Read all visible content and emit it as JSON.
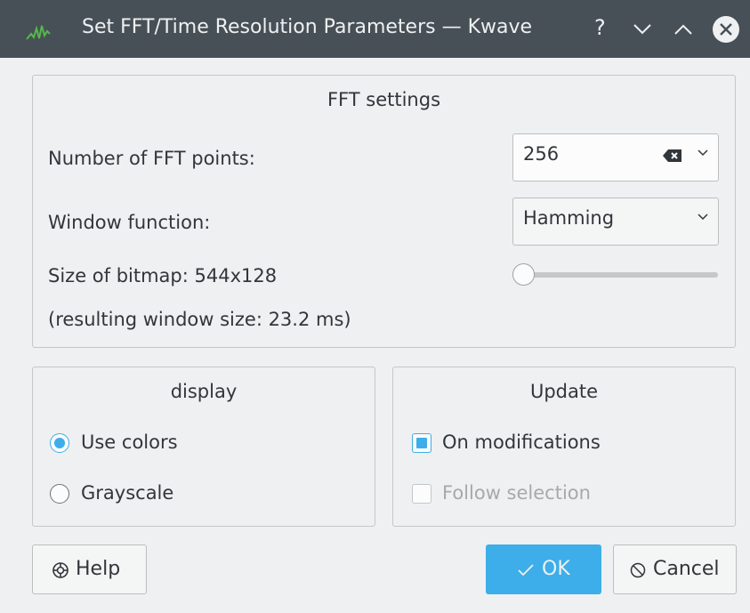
{
  "window": {
    "title": "Set FFT/Time Resolution Parameters — Kwave",
    "help_glyph": "?",
    "accent_color": "#3daee9",
    "titlebar_color": "#475057"
  },
  "fft_settings": {
    "title": "FFT settings",
    "fft_points_label": "Number of FFT points:",
    "fft_points_value": "256",
    "window_function_label": "Window function:",
    "window_function_value": "Hamming",
    "bitmap_size_text": "Size of bitmap: 544x128",
    "window_size_text": "(resulting window size: 23.2 ms)",
    "slider_level": 0
  },
  "display": {
    "title": "display",
    "option_colors": "Use colors",
    "option_grayscale": "Grayscale",
    "selected": "Use colors"
  },
  "update": {
    "title": "Update",
    "on_modifications": "On modifications",
    "on_modifications_checked": true,
    "follow_selection": "Follow selection",
    "follow_selection_checked": false,
    "follow_selection_enabled": false
  },
  "buttons": {
    "help": "Help",
    "ok": "OK",
    "cancel": "Cancel"
  }
}
